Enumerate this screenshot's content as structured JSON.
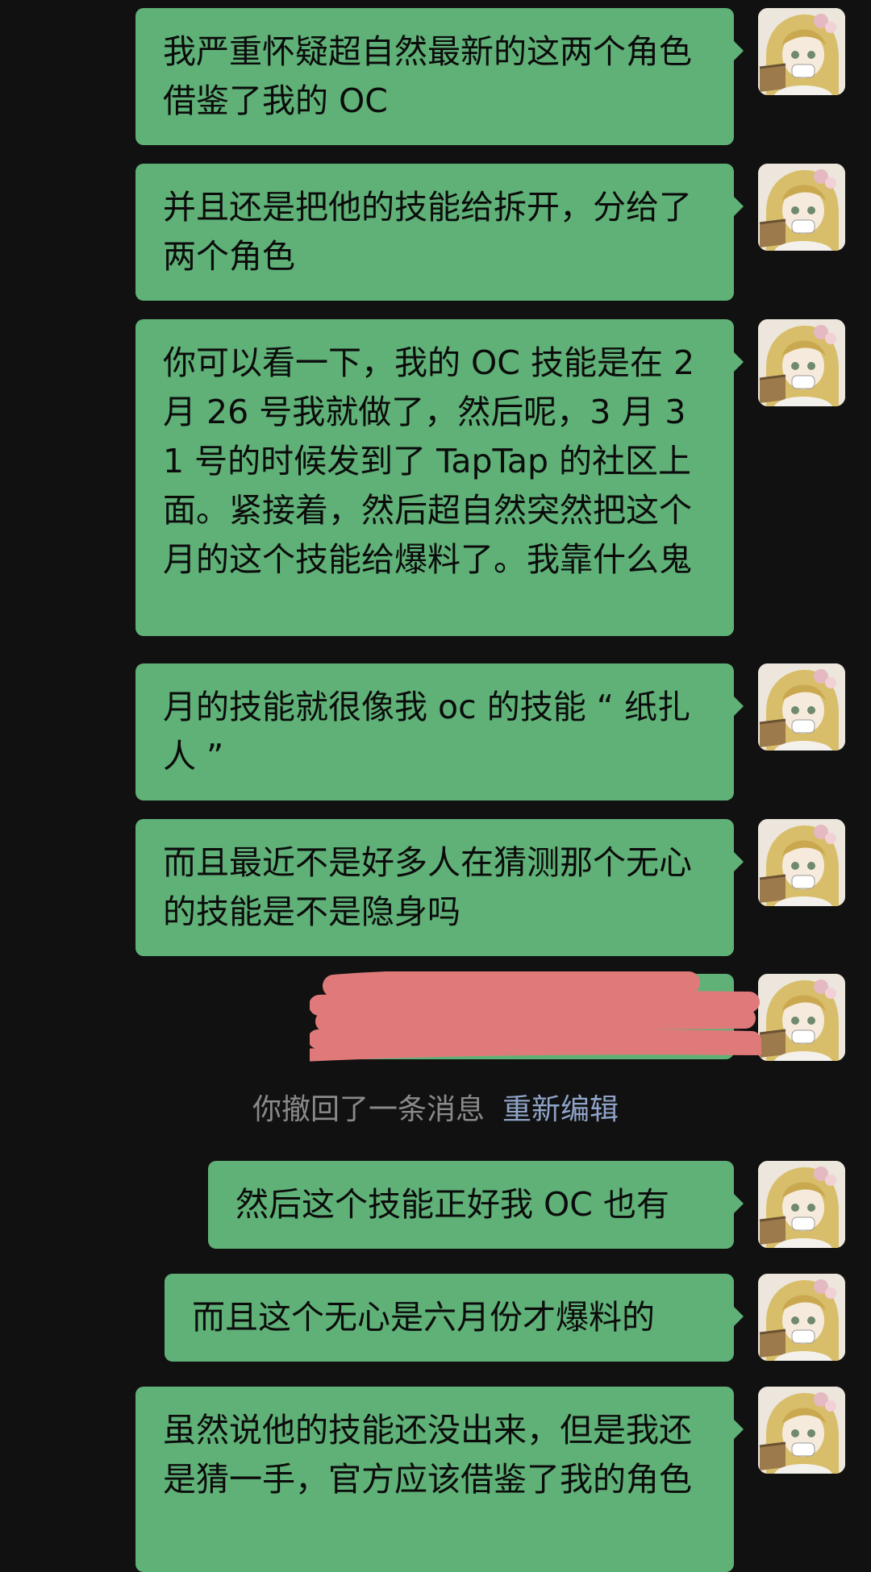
{
  "messages": [
    {
      "text": "我严重怀疑超自然最新的这两个角色借鉴了我的 OC"
    },
    {
      "text": "并且还是把他的技能给拆开，分给了两个角色"
    },
    {
      "text": "你可以看一下，我的 OC 技能是在 2 月 26 号我就做了，然后呢，3 月 31 号的时候发到了 TapTap 的社区上面。紧接着，然后超自然突然把这个月的这个技能给爆料了。我靠什么鬼"
    },
    {
      "text": "月的技能就很像我 oc 的技能 “ 纸扎人 ”"
    },
    {
      "text": "而且最近不是好多人在猜测那个无心的技能是不是隐身吗"
    },
    {
      "text": ""
    },
    {
      "text": "然后这个技能正好我 OC 也有"
    },
    {
      "text": "而且这个无心是六月份才爆料的"
    },
    {
      "text": "虽然说他的技能还没出来，但是我还是猜一手，官方应该借鉴了我的角色"
    }
  ],
  "recall_notice": {
    "text": "你撤回了一条消息",
    "action": "重新编辑"
  },
  "colors": {
    "background": "#111111",
    "bubble": "#5fb177",
    "scribble": "#e07a7a",
    "recall_text": "#8a8a8a",
    "recall_action": "#8fa4c8"
  },
  "icons": {
    "avatar": "anime-girl-avatar-icon"
  }
}
